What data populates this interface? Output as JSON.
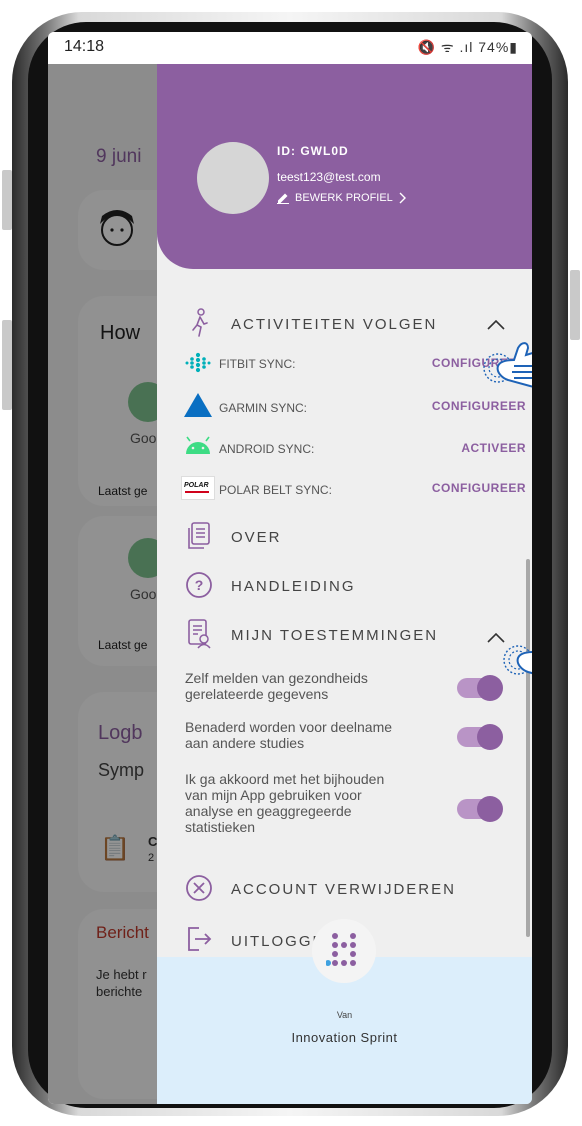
{
  "status_bar": {
    "time": "14:18",
    "icons": "🔇 ᯤ .ıl 74%▮"
  },
  "background": {
    "date": "9 juni",
    "card_title": "How",
    "mood_label": "Goo",
    "last_label": "Laatst ge",
    "mood_label_2": "Goo",
    "last_label_2": "Laatst ge",
    "logbook": "Logb",
    "symptoms": "Symp",
    "sym_item": "C",
    "sym_sub": "2",
    "messages": "Bericht",
    "messages_text_1": "Je hebt r",
    "messages_text_2": "berichte"
  },
  "drawer": {
    "user_id": "ID: GWL0D",
    "email": "teest123@test.com",
    "edit_profile": "BEWERK PROFIEL",
    "activities": {
      "title": "ACTIVITEITEN VOLGEN",
      "rows": [
        {
          "label": "FITBIT SYNC:",
          "action": "CONFIGUREER"
        },
        {
          "label": "GARMIN SYNC:",
          "action": "CONFIGUREER"
        },
        {
          "label": "ANDROID SYNC:",
          "action": "ACTIVEER"
        },
        {
          "label": "POLAR BELT SYNC:",
          "action": "CONFIGUREER"
        }
      ]
    },
    "about": "OVER",
    "manual": "HANDLEIDING",
    "permissions": {
      "title": "MIJN TOESTEMMINGEN",
      "items": [
        {
          "text_1": "Zelf melden van gezondheids",
          "text_2": "gerelateerde gegevens",
          "enabled": true
        },
        {
          "text_1": "Benaderd worden voor deelname",
          "text_2": "aan andere studies",
          "enabled": true
        },
        {
          "text_1": "Ik ga akkoord met het bijhouden",
          "text_2": "van mijn App gebruiken voor",
          "text_3": "analyse en geaggregeerde",
          "text_4": "statistieken",
          "enabled": true
        }
      ]
    },
    "delete_account": "ACCOUNT VERWIJDEREN",
    "logout": "UITLOGGEN",
    "footer": {
      "van": "Van",
      "company": "Innovation Sprint"
    },
    "polar_logo_text": "POLAR"
  },
  "colors": {
    "accent": "#8c5fa0",
    "toggle_track": "#b994c6",
    "footer_bg": "#dceefb",
    "hand_outline": "#1e63b7",
    "fitbit": "#00b0b9",
    "garmin": "#0a6fc2",
    "android": "#3ddc84"
  }
}
